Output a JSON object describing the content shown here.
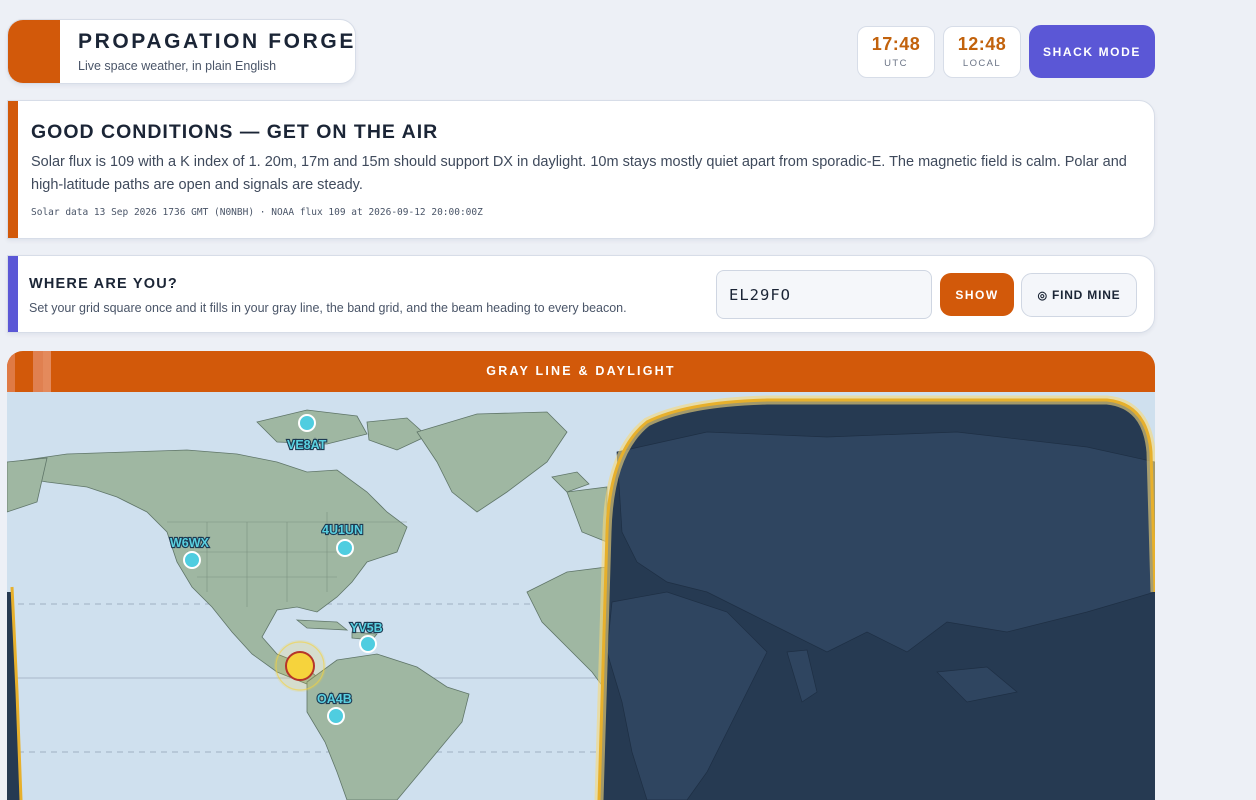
{
  "header": {
    "title": "PROPAGATION FORGE",
    "subtitle": "Live space weather, in plain English"
  },
  "clocks": {
    "utc_time": "17:48",
    "utc_label": "UTC",
    "local_time": "12:48",
    "local_label": "LOCAL"
  },
  "shack_mode_label": "SHACK MODE",
  "conditions": {
    "headline": "GOOD CONDITIONS — GET ON THE AIR",
    "summary": "Solar flux is 109 with a K index of 1. 20m, 17m and 15m should support DX in daylight. 10m stays mostly quiet apart from sporadic-E. The magnetic field is calm. Polar and high-latitude paths are open and signals are steady.",
    "meta": "Solar data 13 Sep 2026 1736 GMT (N0NBH) · NOAA flux 109 at 2026-09-12 20:00:00Z"
  },
  "location": {
    "title": "WHERE ARE YOU?",
    "subtitle": "Set your grid square once and it fills in your gray line, the band grid, and the beam heading to every beacon.",
    "grid_value": "EL29FO",
    "show_label": "SHOW",
    "find_label": "FIND MINE",
    "find_icon": "target-icon"
  },
  "map": {
    "title": "GRAY LINE & DAYLIGHT",
    "beacons": [
      {
        "call": "VE8AT"
      },
      {
        "call": "W6WX"
      },
      {
        "call": "4U1UN"
      },
      {
        "call": "YV5B"
      },
      {
        "call": "OA4B"
      }
    ],
    "colors": {
      "ocean": "#cfe0ee",
      "land": "#9fb7a2",
      "night": "#263a52",
      "terminator": "#f2c34a",
      "beacon": "#4fcde0",
      "sun": "#f6d33c"
    }
  }
}
